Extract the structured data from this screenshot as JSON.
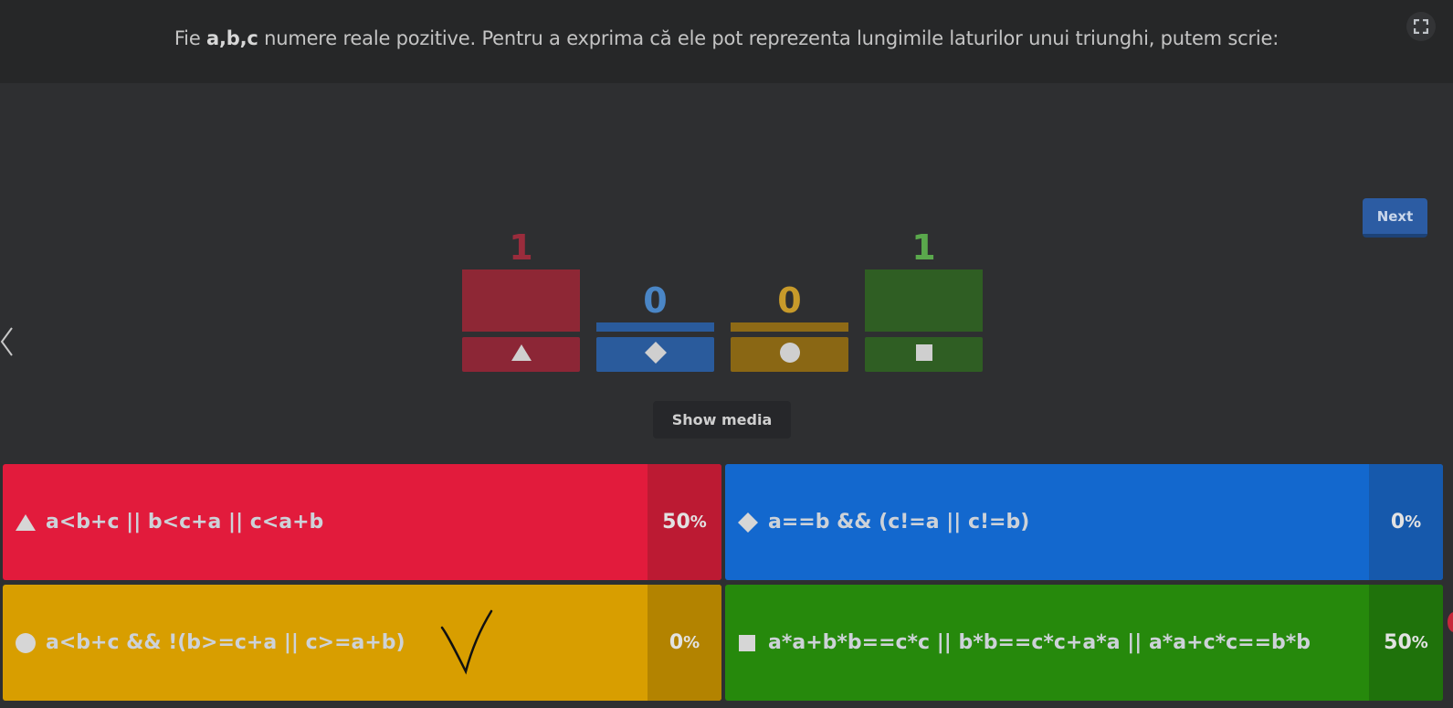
{
  "question": {
    "prefix": "Fie ",
    "bold": "a,b,c",
    "suffix": " numere reale pozitive. Pentru a exprima că ele pot reprezenta lungimile laturilor unui triunghi, putem scrie:"
  },
  "buttons": {
    "next": "Next",
    "show_media": "Show media"
  },
  "results": [
    {
      "count": "1",
      "shape": "triangle-icon",
      "color": "#8e2735",
      "base_color": "#8c2636",
      "count_color": "#9a2c3c"
    },
    {
      "count": "0",
      "shape": "diamond-icon",
      "color": "#2a5b9c",
      "base_color": "#2a5b9c",
      "count_color": "#4a86c6"
    },
    {
      "count": "0",
      "shape": "circle-icon",
      "color": "#8e6a16",
      "base_color": "#8a6714",
      "count_color": "#c79a2a"
    },
    {
      "count": "1",
      "shape": "square-icon",
      "color": "#2f5e23",
      "base_color": "#2f5e23",
      "count_color": "#5aa84c"
    }
  ],
  "answers": [
    {
      "text": "a<b+c || b<c+a || c<a+b",
      "percent": "50",
      "icon": "triangle-icon",
      "color": "#e21b3c",
      "pct_color": "#bc1a33"
    },
    {
      "text": "a==b && (c!=a || c!=b)",
      "percent": "0",
      "icon": "diamond-icon",
      "color": "#1368ce",
      "pct_color": "#1659ac"
    },
    {
      "text": "a<b+c && !(b>=c+a || c>=a+b)",
      "percent": "0",
      "icon": "circle-icon",
      "color": "#d89e00",
      "pct_color": "#b38300"
    },
    {
      "text": "a*a+b*b==c*c || b*b==c*c+a*a || a*a+c*c==b*b",
      "percent": "50",
      "icon": "square-icon",
      "color": "#26890c",
      "pct_color": "#1f720b"
    }
  ],
  "percent_sign": "%"
}
